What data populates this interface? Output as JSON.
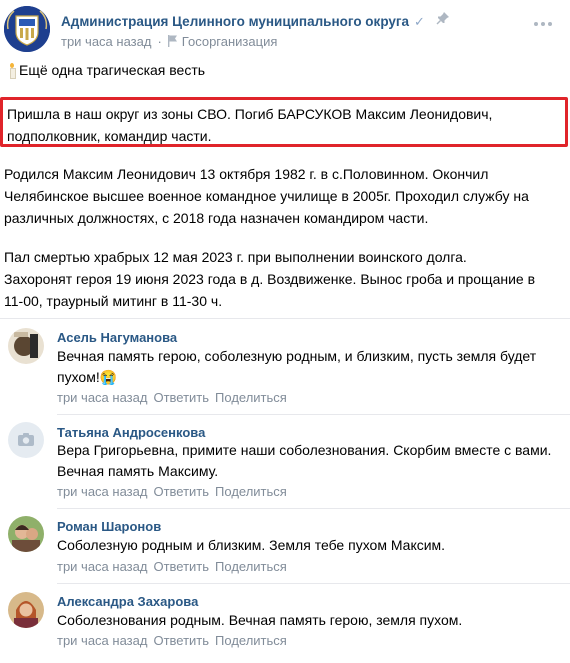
{
  "post": {
    "group_name": "Администрация Целинного муниципального округа",
    "verified_mark": "✓",
    "time": "три часа назад",
    "category": "Госорганизация",
    "intro": "Ещё одна трагическая весть",
    "highlight_lines": [
      "Пришла в наш округ из зоны СВО. Погиб БАРСУКОВ Максим Леонидович,",
      "подполковник, командир части."
    ],
    "para2_lines": [
      "Родился Максим Леонидович 13 октября 1982 г. в с.Половинном. Окончил",
      "Челябинское высшее военное командное училище в 2005г. Проходил службу на",
      "различных должностях, с 2018 года назначен командиром части."
    ],
    "para3_lines": [
      "Пал смертью храбрых 12 мая 2023 г. при выполнении воинского долга.",
      "Захоронят героя 19 июня 2023 года в д. Воздвиженке. Вынос гроба и прощание в",
      "11-00, траурный митинг в 11-30 ч."
    ]
  },
  "comments": [
    {
      "author": "Асель Нагуманова",
      "lines": [
        "Вечная память герою, соболезную родным, и близким, пусть земля будет",
        "пухом!😭"
      ],
      "time": "три часа назад",
      "reply": "Ответить",
      "share": "Поделиться"
    },
    {
      "author": "Татьяна Андросенкова",
      "lines": [
        "Вера Григорьевна, примите наши соболезнования. Скорбим вместе с вами.",
        "Вечная память Максиму."
      ],
      "time": "три часа назад",
      "reply": "Ответить",
      "share": "Поделиться"
    },
    {
      "author": "Роман Шаронов",
      "lines": [
        "Соболезную родным и близким. Земля тебе пухом Максим."
      ],
      "time": "три часа назад",
      "reply": "Ответить",
      "share": "Поделиться"
    },
    {
      "author": "Александра Захарова",
      "lines": [
        "Соболезнования родным. Вечная память герою, земля пухом."
      ],
      "time": "три часа назад",
      "reply": "Ответить",
      "share": "Поделиться"
    }
  ],
  "colors": {
    "link": "#2a5885",
    "meta": "#818c99",
    "highlight_border": "#e0242a",
    "group_avatar_bg": "#1e3f8f"
  },
  "icons": {
    "verified": "check-icon",
    "pin": "pin-icon",
    "category": "flag-icon",
    "more": "more-dots-icon",
    "intro": "candle-icon",
    "placeholder_avatar": "camera-icon"
  }
}
